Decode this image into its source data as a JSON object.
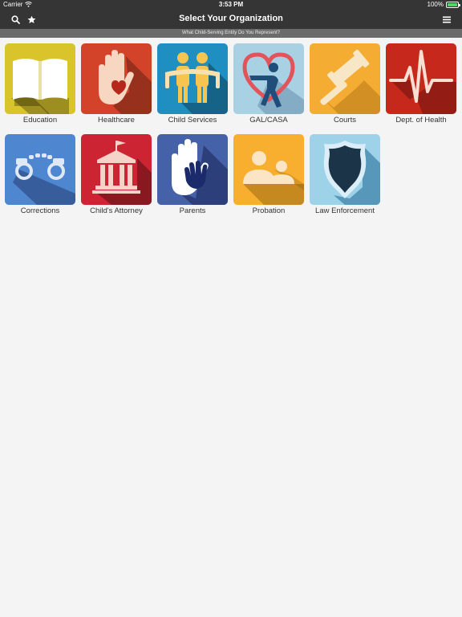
{
  "status": {
    "carrier": "Carrier",
    "time": "3:53 PM",
    "battery": "100%",
    "battery_level": 1.0
  },
  "navbar": {
    "title": "Select Your Organization"
  },
  "subheader": {
    "text": "What Child-Serving Entity Do You Represent?"
  },
  "organizations": [
    {
      "label": "Education",
      "color": "#d9c52b",
      "icon": "book-icon"
    },
    {
      "label": "Healthcare",
      "color": "#d3432a",
      "icon": "hand-heart-icon"
    },
    {
      "label": "Child Services",
      "color": "#1f8ec0",
      "icon": "children-icon"
    },
    {
      "label": "GAL/CASA",
      "color": "#a9d1e4",
      "icon": "person-heart-icon"
    },
    {
      "label": "Courts",
      "color": "#f5ac33",
      "icon": "gavel-icon"
    },
    {
      "label": "Dept. of Health",
      "color": "#c7281c",
      "icon": "heartbeat-icon"
    },
    {
      "label": "Corrections",
      "color": "#4f86d0",
      "icon": "handcuffs-icon"
    },
    {
      "label": "Child's Attorney",
      "color": "#cc2432",
      "icon": "courthouse-icon"
    },
    {
      "label": "Parents",
      "color": "#4561a8",
      "icon": "hands-icon"
    },
    {
      "label": "Probation",
      "color": "#f8ae2f",
      "icon": "adult-child-icon"
    },
    {
      "label": "Law Enforcement",
      "color": "#9ed2e8",
      "icon": "badge-icon"
    }
  ]
}
